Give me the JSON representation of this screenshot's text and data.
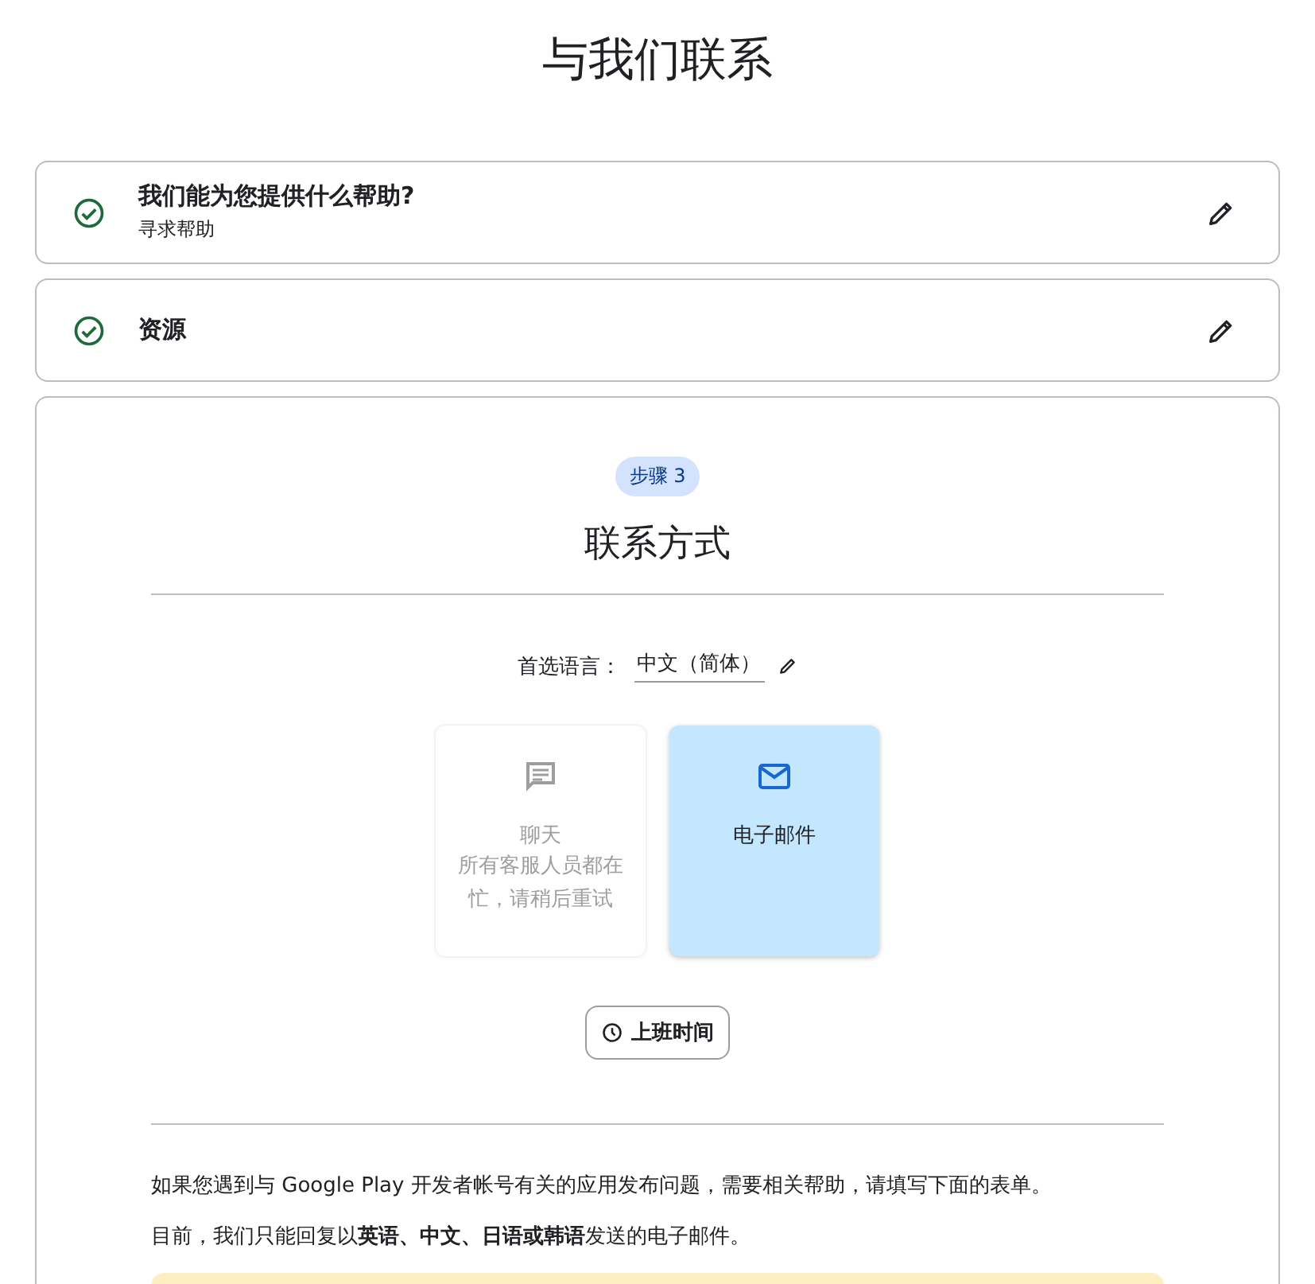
{
  "page_title": "与我们联系",
  "steps": [
    {
      "title": "我们能为您提供什么帮助?",
      "subtitle": "寻求帮助",
      "completed": true
    },
    {
      "title": "资源",
      "completed": true
    }
  ],
  "current_step": {
    "badge": "步骤 3",
    "title": "联系方式",
    "language": {
      "label": "首选语言：",
      "value": "中文（简体）"
    },
    "options": [
      {
        "kind": "chat",
        "label": "聊天",
        "note": "所有客服人员都在忙，请稍后重试",
        "disabled": true,
        "selected": false
      },
      {
        "kind": "email",
        "label": "电子邮件",
        "disabled": false,
        "selected": true
      }
    ],
    "hours_button": "上班时间",
    "paragraphs": [
      "如果您遇到与 Google Play 开发者帐号有关的应用发布问题，需要相关帮助，请填写下面的表单。",
      "目前，我们只能回复以**英语、中文、日语或韩语**发送的电子邮件。"
    ]
  }
}
